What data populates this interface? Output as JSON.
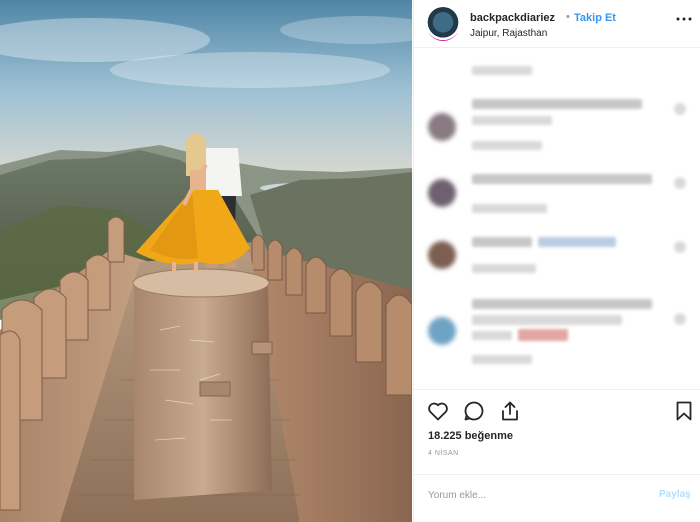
{
  "post": {
    "username": "backpackdiariez",
    "separator": "•",
    "follow_label": "Takip Et",
    "location": "Jaipur, Rajasthan",
    "likes": "18.225 beğenme",
    "date": "4 NİSAN"
  },
  "icons": {
    "more": "more-options-icon",
    "like": "heart-icon",
    "comment": "comment-icon",
    "share": "share-icon",
    "save": "bookmark-icon"
  },
  "comment_form": {
    "placeholder": "Yorum ekle...",
    "post_label": "Paylaş"
  },
  "colors": {
    "accent": "#3897f0",
    "post_disabled": "#b2dffc",
    "dress": "#f0a818"
  }
}
